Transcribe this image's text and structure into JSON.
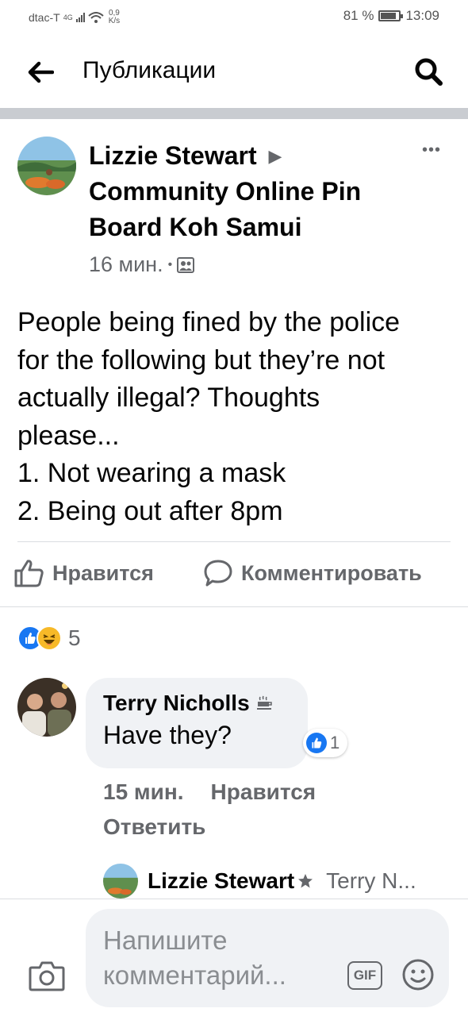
{
  "status_bar": {
    "carrier": "dtac-T",
    "network": "4G",
    "speed_value": "0,9",
    "speed_unit": "K/s",
    "battery": "81 %",
    "time": "13:09"
  },
  "topbar": {
    "title": "Публикации",
    "back_icon": "back-arrow-icon",
    "search_icon": "search-icon"
  },
  "post": {
    "author": "Lizzie Stewart",
    "arrow": "▶",
    "group": "Community Online Pin Board Koh Samui",
    "time": "16 мин.",
    "dot": "•",
    "privacy_icon": "group-icon",
    "more": "•••",
    "text_lines": [
      "People being fined by the police",
      "for the following but they’re not",
      "actually illegal? Thoughts",
      "please...",
      "1. Not wearing a mask",
      "2. Being out after 8pm"
    ]
  },
  "actions": {
    "like": "Нравится",
    "comment": "Комментировать"
  },
  "reactions": {
    "count": "5"
  },
  "comments": [
    {
      "author": "Terry Nicholls",
      "text": "Have they?",
      "likes": "1",
      "time": "15 мин.",
      "like_label": "Нравится",
      "reply_label": "Ответить"
    }
  ],
  "reply_preview": {
    "author": "Lizzie Stewart",
    "to": "Terry N..."
  },
  "composer": {
    "placeholder": "Напишите комментарий...",
    "gif": "GIF"
  },
  "colors": {
    "accent": "#1877f2",
    "secondary_text": "#65676b",
    "bubble": "#f0f2f5"
  }
}
